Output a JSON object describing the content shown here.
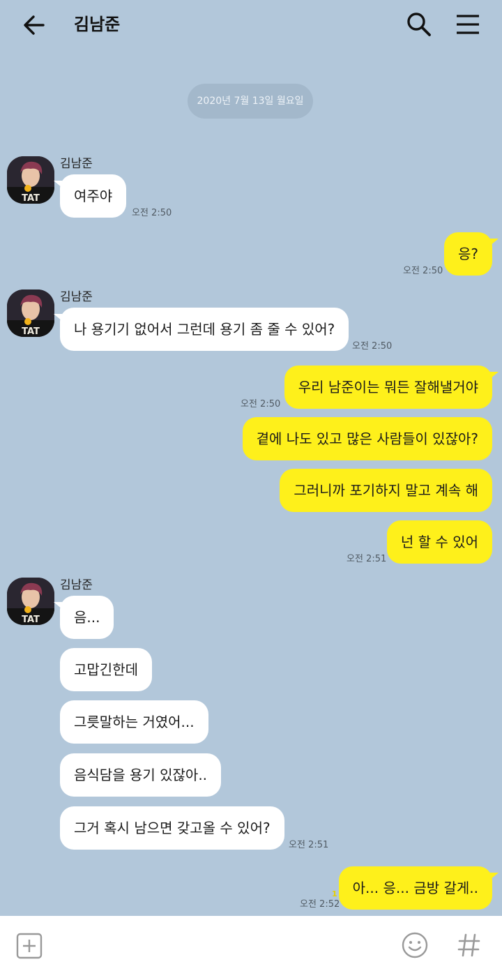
{
  "header": {
    "title": "김남준"
  },
  "date_divider": "2020년 7월 13일 월요일",
  "messages": {
    "g1": {
      "sender": "김남준",
      "m1": "여주야",
      "time": "오전 2:50"
    },
    "o1": {
      "m1": "응?",
      "time": "오전 2:50"
    },
    "g2": {
      "sender": "김남준",
      "m1": "나 용기기 없어서 그런데 용기 좀 줄 수 있어?",
      "time": "오전 2:50"
    },
    "o2": {
      "m1": "우리 남준이는 뭐든 잘해낼거야",
      "time1": "오전 2:50",
      "m2": "곁에 나도 있고 많은 사람들이 있잖아?",
      "m3": "그러니까 포기하지 말고 계속 해",
      "m4": "넌 할 수 있어",
      "time": "오전 2:51"
    },
    "g3": {
      "sender": "김남준",
      "m1": "음...",
      "m2": "고맙긴한데",
      "m3": "그릇말하는 거였어...",
      "m4": "음식담을 용기 있잖아..",
      "m5": "그거 혹시 남으면 갖고올 수 있어?",
      "time": "오전 2:51"
    },
    "o3": {
      "m1": "아... 응... 금방 갈게..",
      "unread": "1",
      "time": "오전 2:52"
    }
  },
  "icons": {
    "back": "arrow-left-icon",
    "search": "search-icon",
    "menu": "menu-icon",
    "add": "plus-square-icon",
    "emoji": "emoji-icon",
    "hash": "hashtag-icon"
  },
  "colors": {
    "background": "#b2c7da",
    "incoming_bubble": "#ffffff",
    "outgoing_bubble": "#fef01b",
    "date_pill": "#a3b8cb"
  }
}
